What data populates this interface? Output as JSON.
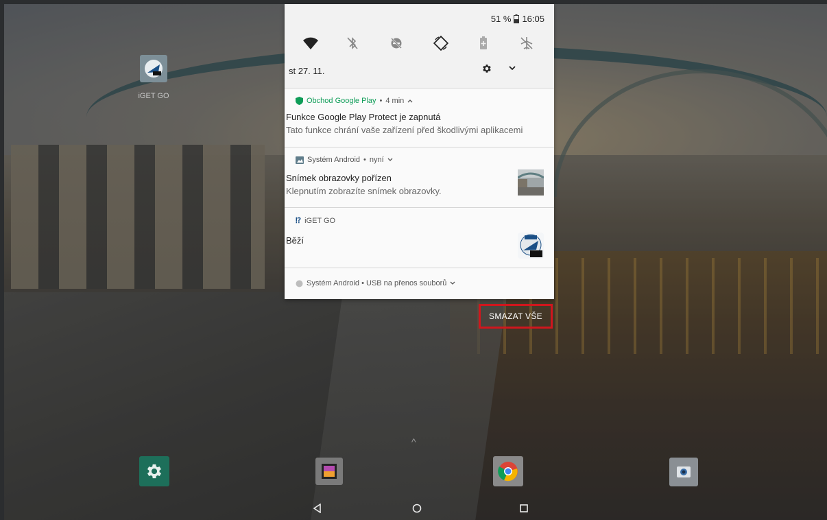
{
  "status_bar": {
    "battery_percent": "51 %",
    "time": "16:05",
    "battery_icon": "battery-icon"
  },
  "quick_settings": {
    "date": "st 27. 11.",
    "toggles": [
      {
        "name": "wifi",
        "icon": "wifi-icon",
        "state": "on"
      },
      {
        "name": "bluetooth",
        "icon": "bluetooth-off-icon",
        "state": "off"
      },
      {
        "name": "do-not-disturb",
        "icon": "dnd-off-icon",
        "state": "off"
      },
      {
        "name": "auto-rotate",
        "icon": "auto-rotate-icon",
        "state": "on"
      },
      {
        "name": "battery-saver",
        "icon": "battery-saver-icon",
        "state": "off"
      },
      {
        "name": "airplane-mode",
        "icon": "airplane-off-icon",
        "state": "off"
      }
    ]
  },
  "notifications": [
    {
      "app": "Obchod Google Play",
      "time": "4 min",
      "title": "Funkce Google Play Protect je zapnutá",
      "text": "Tato funkce chrání vaše zařízení před škodlivými aplikacemi",
      "accent": "#0f9d58"
    },
    {
      "app": "Systém Android",
      "time": "nyní",
      "title": "Snímek obrazovky pořízen",
      "text": "Klepnutím zobrazíte snímek obrazovky."
    },
    {
      "app": "iGET GO",
      "title": "Běží"
    },
    {
      "summary": "Systém Android • USB na přenos souborů"
    }
  ],
  "clear_all_label": "SMAZAT VŠE",
  "home": {
    "iget_label": "iGET GO",
    "dock": [
      "settings-icon",
      "gallery-icon",
      "chrome-icon",
      "camera-icon"
    ]
  },
  "colors": {
    "highlight_box": "#d0161d",
    "play_green": "#0f9d58"
  }
}
